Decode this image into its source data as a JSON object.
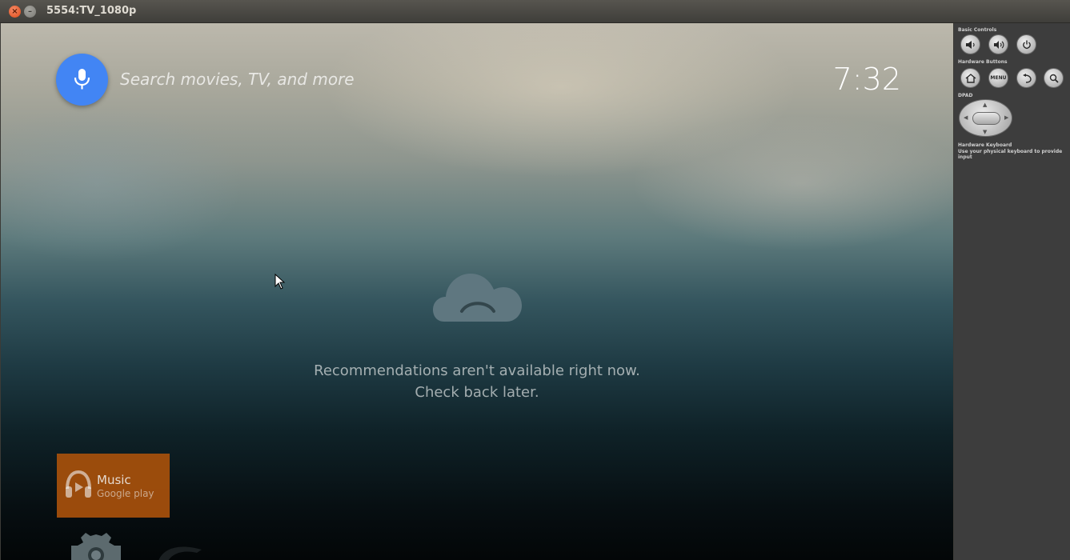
{
  "window": {
    "title": "5554:TV_1080p",
    "close_glyph": "×",
    "minimize_glyph": "–"
  },
  "tv": {
    "search": {
      "placeholder": "Search movies, TV, and more",
      "mic_icon": "microphone-icon"
    },
    "clock": "7:32",
    "message": {
      "line1": "Recommendations aren't available right now.",
      "line2": "Check back later."
    },
    "apps": [
      {
        "title": "Music",
        "subtitle": "Google play",
        "color": "#a34f0c"
      }
    ]
  },
  "panel": {
    "basic_controls_label": "Basic Controls",
    "hardware_buttons_label": "Hardware Buttons",
    "dpad_label": "DPAD",
    "keyboard_label": "Hardware Keyboard",
    "keyboard_desc": "Use your physical keyboard to provide input",
    "menu_label": "MENU"
  },
  "colors": {
    "mic_blue": "#4285f4",
    "music_tile": "#a34f0c",
    "panel_bg": "#3d3d3d"
  }
}
